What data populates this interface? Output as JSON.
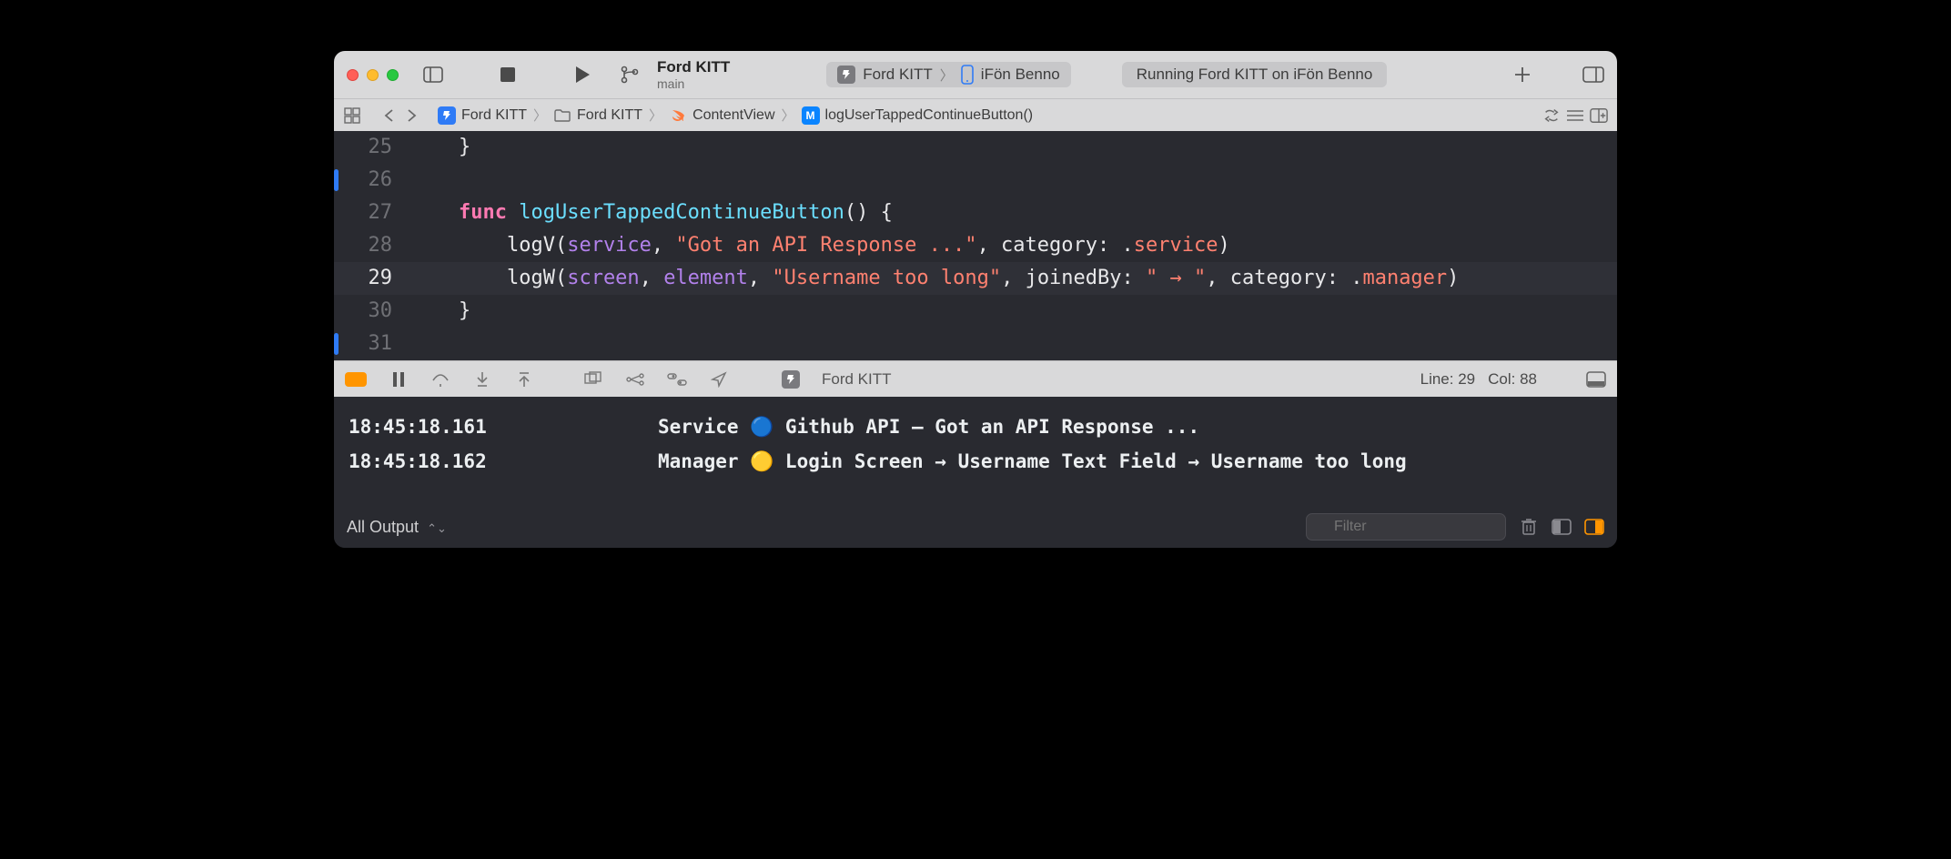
{
  "titlebar": {
    "project": "Ford KITT",
    "branch": "main",
    "scheme_project": "Ford KITT",
    "scheme_device": "iFön Benno",
    "status": "Running Ford KITT on iFön Benno"
  },
  "breadcrumb": {
    "items": [
      "Ford KITT",
      "Ford KITT",
      "ContentView",
      "logUserTappedContinueButton()"
    ]
  },
  "editor": {
    "lines": [
      {
        "n": 25,
        "mark": false,
        "text": "    }"
      },
      {
        "n": 26,
        "mark": true,
        "text": ""
      },
      {
        "n": 27,
        "mark": false,
        "tokens": [
          [
            "    ",
            ""
          ],
          [
            "func",
            "kw"
          ],
          [
            " ",
            ""
          ],
          [
            "logUserTappedContinueButton",
            "fn"
          ],
          [
            "() {",
            "id"
          ]
        ]
      },
      {
        "n": 28,
        "mark": false,
        "tokens": [
          [
            "        ",
            ""
          ],
          [
            "logV",
            "id"
          ],
          [
            "(",
            ""
          ],
          [
            "service",
            "prop"
          ],
          [
            ", ",
            ""
          ],
          [
            "\"Got an API Response ...\"",
            "str"
          ],
          [
            ", category: .",
            ""
          ],
          [
            "service",
            "enum"
          ],
          [
            ")",
            ""
          ]
        ]
      },
      {
        "n": 29,
        "mark": false,
        "hl": true,
        "tokens": [
          [
            "        ",
            ""
          ],
          [
            "logW",
            "id"
          ],
          [
            "(",
            ""
          ],
          [
            "screen",
            "prop"
          ],
          [
            ", ",
            ""
          ],
          [
            "element",
            "prop"
          ],
          [
            ", ",
            ""
          ],
          [
            "\"Username too long\"",
            "str"
          ],
          [
            ", joinedBy: ",
            ""
          ],
          [
            "\" → \"",
            "str"
          ],
          [
            ", category: .",
            ""
          ],
          [
            "manager",
            "enum"
          ],
          [
            ")",
            ""
          ]
        ]
      },
      {
        "n": 30,
        "mark": false,
        "text": "    }"
      },
      {
        "n": 31,
        "mark": true,
        "text": ""
      }
    ]
  },
  "debugbar": {
    "target": "Ford KITT",
    "cursor_line": "Line: 29",
    "cursor_col": "Col: 88"
  },
  "console": {
    "rows": [
      {
        "ts": "18:45:18.161",
        "msg": "Service 🔵 Github API – Got an API Response ..."
      },
      {
        "ts": "18:45:18.162",
        "msg": "Manager 🟡 Login Screen → Username Text Field → Username too long"
      }
    ],
    "output_scope": "All Output",
    "filter_placeholder": "Filter"
  }
}
